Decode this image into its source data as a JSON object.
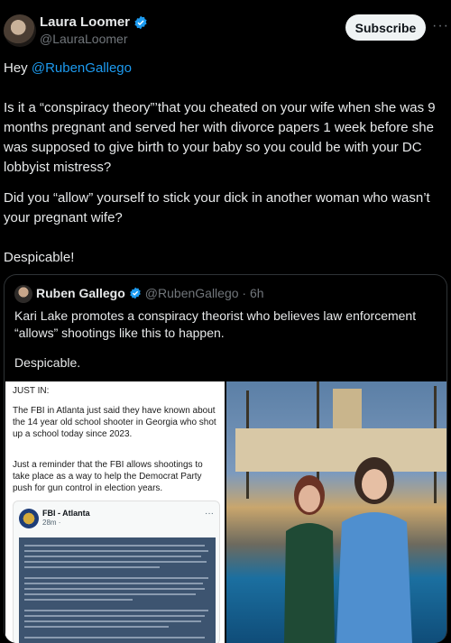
{
  "post": {
    "author_name": "Laura Loomer",
    "author_handle": "@LauraLoomer",
    "subscribe_label": "Subscribe",
    "more_label": "···",
    "greeting": "Hey ",
    "mention": "@RubenGallego",
    "paragraph1": "Is it a “conspiracy theory”’that you cheated on your wife when she was 9 months pregnant and served her with divorce papers 1 week before she was supposed to give birth to your baby so you could be with your DC lobbyist mistress?",
    "paragraph2": "Did you “allow” yourself to stick your dick in another woman who wasn’t your pregnant wife?",
    "paragraph3": "Despicable!"
  },
  "quote": {
    "author_name": "Ruben Gallego",
    "author_handle": "@RubenGallego · 6h",
    "text1": "Kari Lake promotes a conspiracy theorist who believes law enforcement “allows” shootings like this to happen.",
    "text2": "Despicable.",
    "screenshot": {
      "header": "JUST IN:",
      "p1": "The FBI in Atlanta just said they have known about the 14 year old school shooter in Georgia who shot up a school today since 2023.",
      "p2": "Just a reminder that the FBI allows shootings to take place as a way to help the Democrat Party push for gun control in election years.",
      "card_name": "FBI - Atlanta",
      "card_time": "28m ·",
      "card_more": "···"
    }
  },
  "colors": {
    "accent": "#1d9bf0",
    "background": "#000000",
    "text": "#e7e9ea",
    "muted": "#71767b"
  },
  "icons": [
    "verified-badge-icon",
    "more-icon"
  ]
}
